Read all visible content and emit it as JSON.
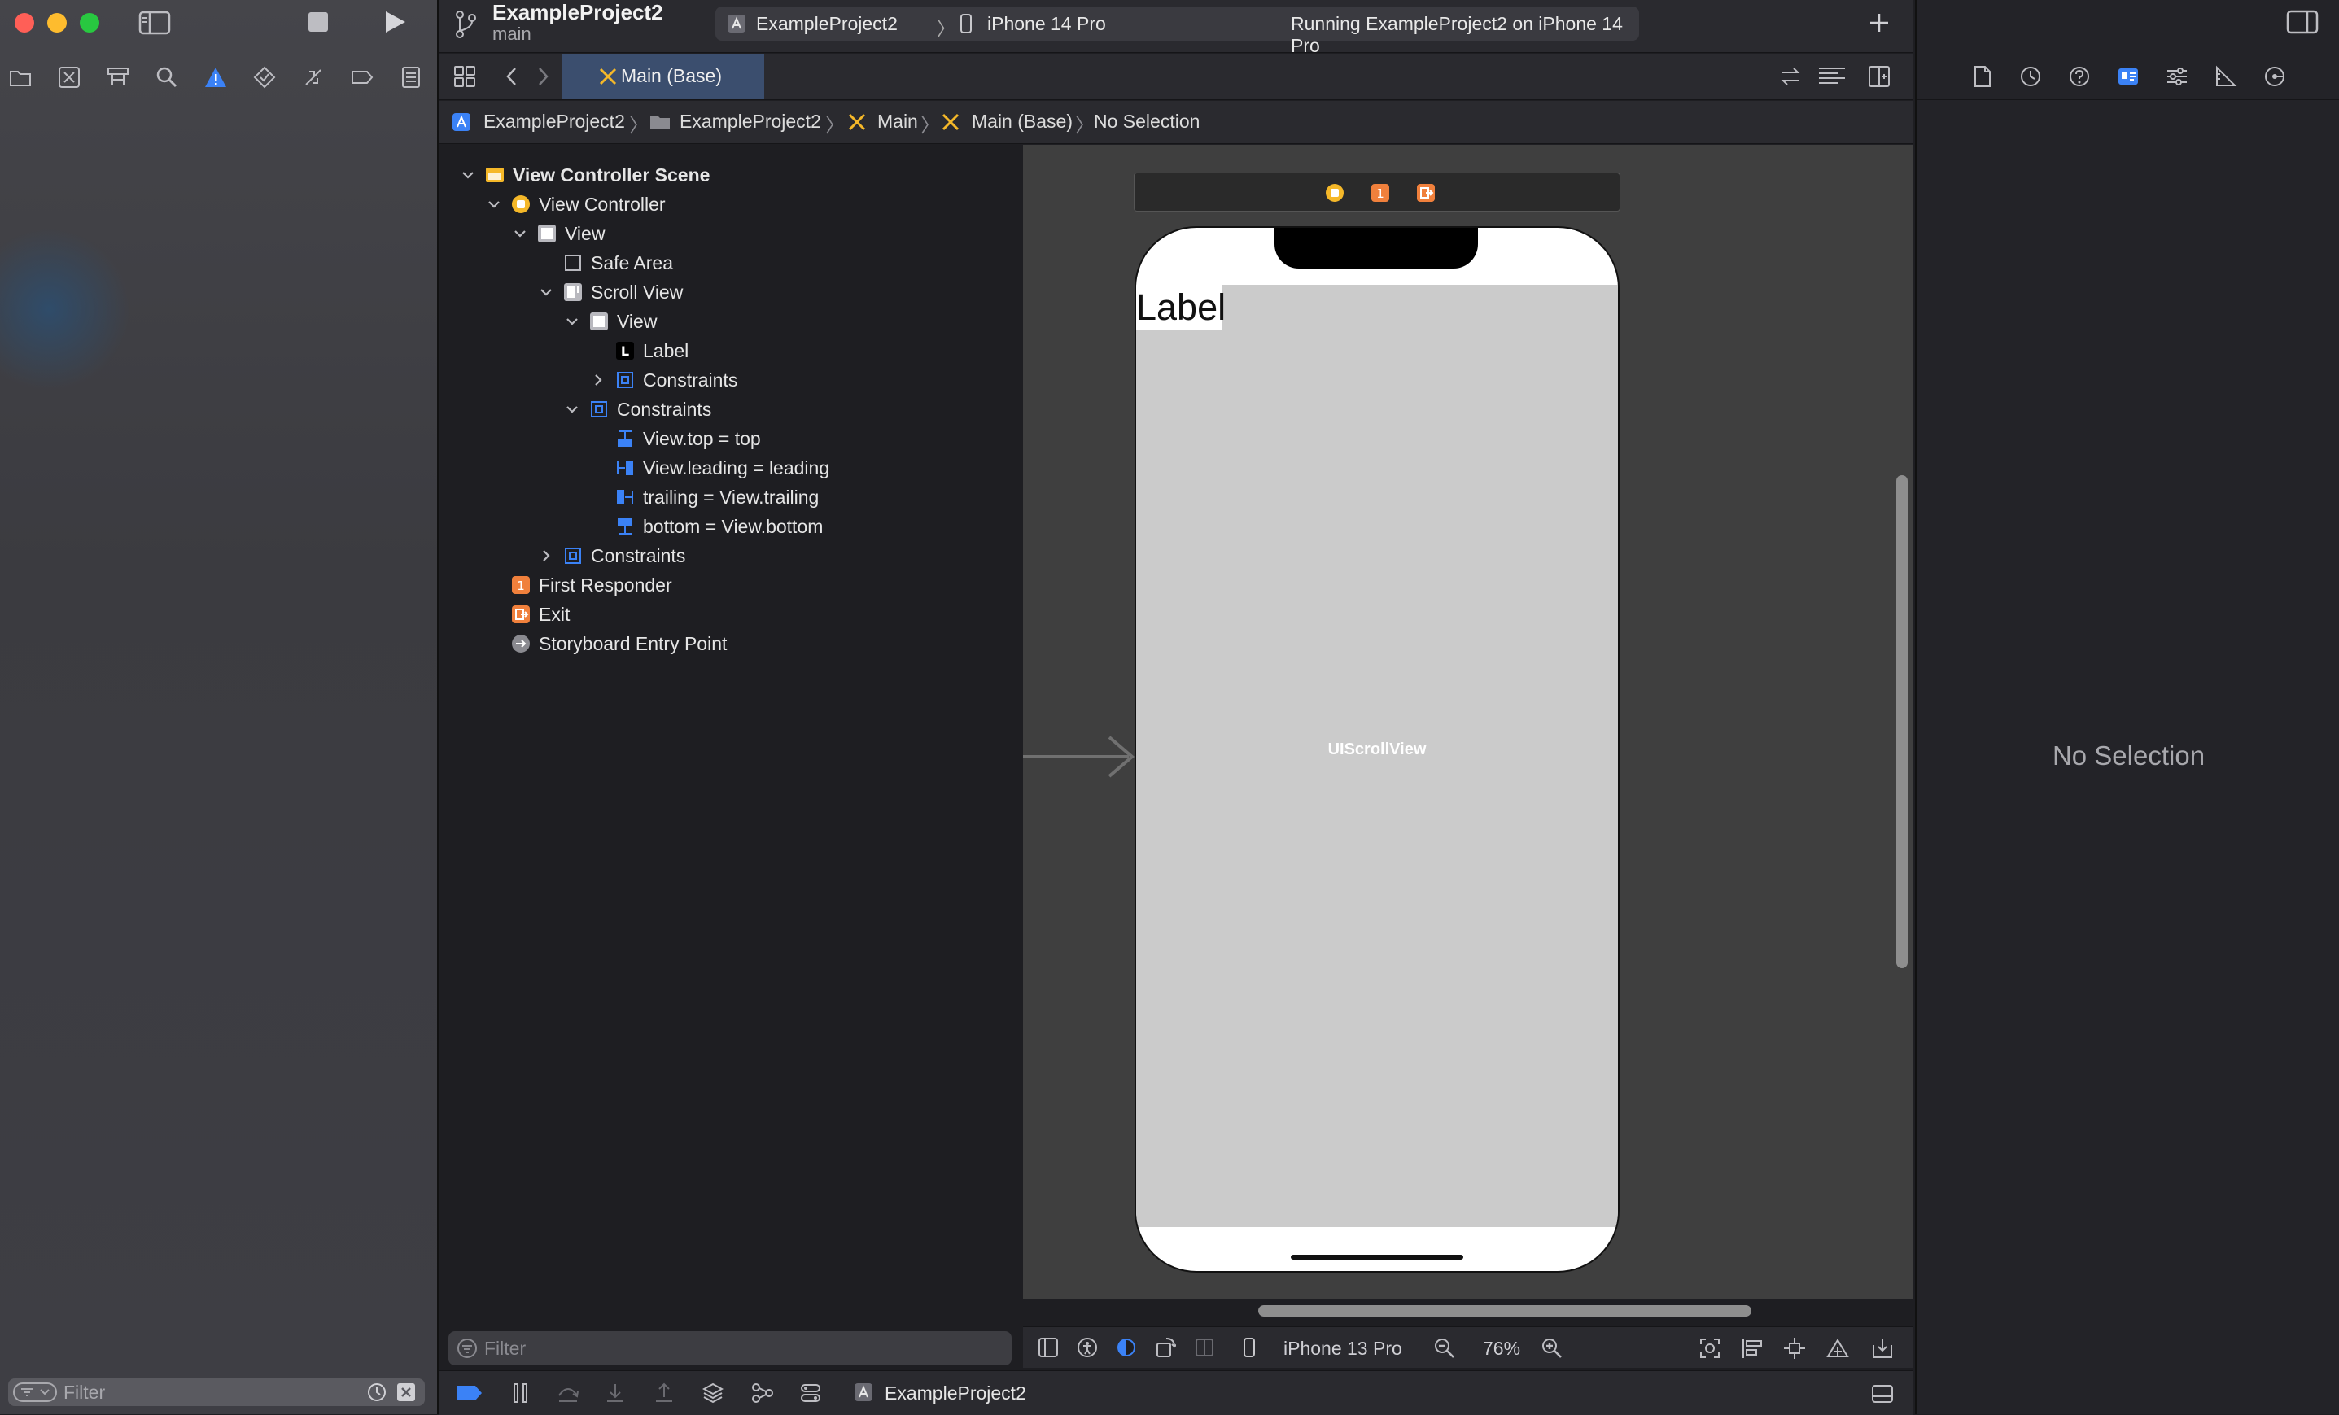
{
  "window": {
    "project_title": "ExampleProject2",
    "branch": "main"
  },
  "toolbar": {
    "scheme_name": "ExampleProject2",
    "destination": "iPhone 14 Pro",
    "status": "Running ExampleProject2 on iPhone 14 Pro",
    "icons": [
      "sidebar-toggle-icon",
      "stop-icon",
      "run-icon",
      "branch-icon",
      "add-icon",
      "inspector-toggle-icon"
    ]
  },
  "navigator": {
    "icons": [
      "folder-icon",
      "source-control-icon",
      "symbol-icon",
      "find-icon",
      "issue-warning-icon",
      "test-icon",
      "debug-icon",
      "breakpoint-icon",
      "report-icon"
    ],
    "filter_placeholder": "Filter"
  },
  "editor": {
    "tab_label": "Main (Base)",
    "breadcrumbs": [
      "ExampleProject2",
      "ExampleProject2",
      "Main",
      "Main (Base)",
      "No Selection"
    ]
  },
  "outline": {
    "filter_placeholder": "Filter",
    "rows": [
      {
        "label": "View Controller Scene",
        "bold": true,
        "indent": 0,
        "disclosure": "open",
        "icon": "scene-icon"
      },
      {
        "label": "View Controller",
        "indent": 1,
        "disclosure": "open",
        "icon": "view-controller-icon"
      },
      {
        "label": "View",
        "indent": 2,
        "disclosure": "open",
        "icon": "view-icon"
      },
      {
        "label": "Safe Area",
        "indent": 3,
        "disclosure": "none",
        "icon": "safe-area-icon"
      },
      {
        "label": "Scroll View",
        "indent": 3,
        "disclosure": "open",
        "icon": "scroll-view-icon"
      },
      {
        "label": "View",
        "indent": 4,
        "disclosure": "open",
        "icon": "view-icon"
      },
      {
        "label": "Label",
        "indent": 5,
        "disclosure": "none",
        "icon": "label-icon"
      },
      {
        "label": "Constraints",
        "indent": 5,
        "disclosure": "closed",
        "icon": "constraints-icon"
      },
      {
        "label": "Constraints",
        "indent": 4,
        "disclosure": "open",
        "icon": "constraints-icon"
      },
      {
        "label": "View.top = top",
        "indent": 5,
        "disclosure": "none",
        "icon": "constraint-top-icon"
      },
      {
        "label": "View.leading = leading",
        "indent": 5,
        "disclosure": "none",
        "icon": "constraint-leading-icon"
      },
      {
        "label": "trailing = View.trailing",
        "indent": 5,
        "disclosure": "none",
        "icon": "constraint-trailing-icon"
      },
      {
        "label": "bottom = View.bottom",
        "indent": 5,
        "disclosure": "none",
        "icon": "constraint-bottom-icon"
      },
      {
        "label": "Constraints",
        "indent": 3,
        "disclosure": "closed",
        "icon": "constraints-icon"
      },
      {
        "label": "First Responder",
        "indent": 1,
        "disclosure": "none",
        "icon": "first-responder-icon"
      },
      {
        "label": "Exit",
        "indent": 1,
        "disclosure": "none",
        "icon": "exit-icon"
      },
      {
        "label": "Storyboard Entry Point",
        "indent": 1,
        "disclosure": "none",
        "icon": "entry-point-icon"
      }
    ]
  },
  "canvas": {
    "label_text": "Label",
    "scroll_view_caption": "UIScrollView",
    "device": "iPhone 13 Pro",
    "zoom": "76%"
  },
  "debugbar": {
    "target": "ExampleProject2"
  },
  "inspector": {
    "empty_message": "No Selection"
  },
  "colors": {
    "accent_blue": "#3b82f6",
    "scene_yellow": "#f5b829",
    "responder_orange": "#f0803c",
    "selected_tab": "#3b4e6e"
  }
}
